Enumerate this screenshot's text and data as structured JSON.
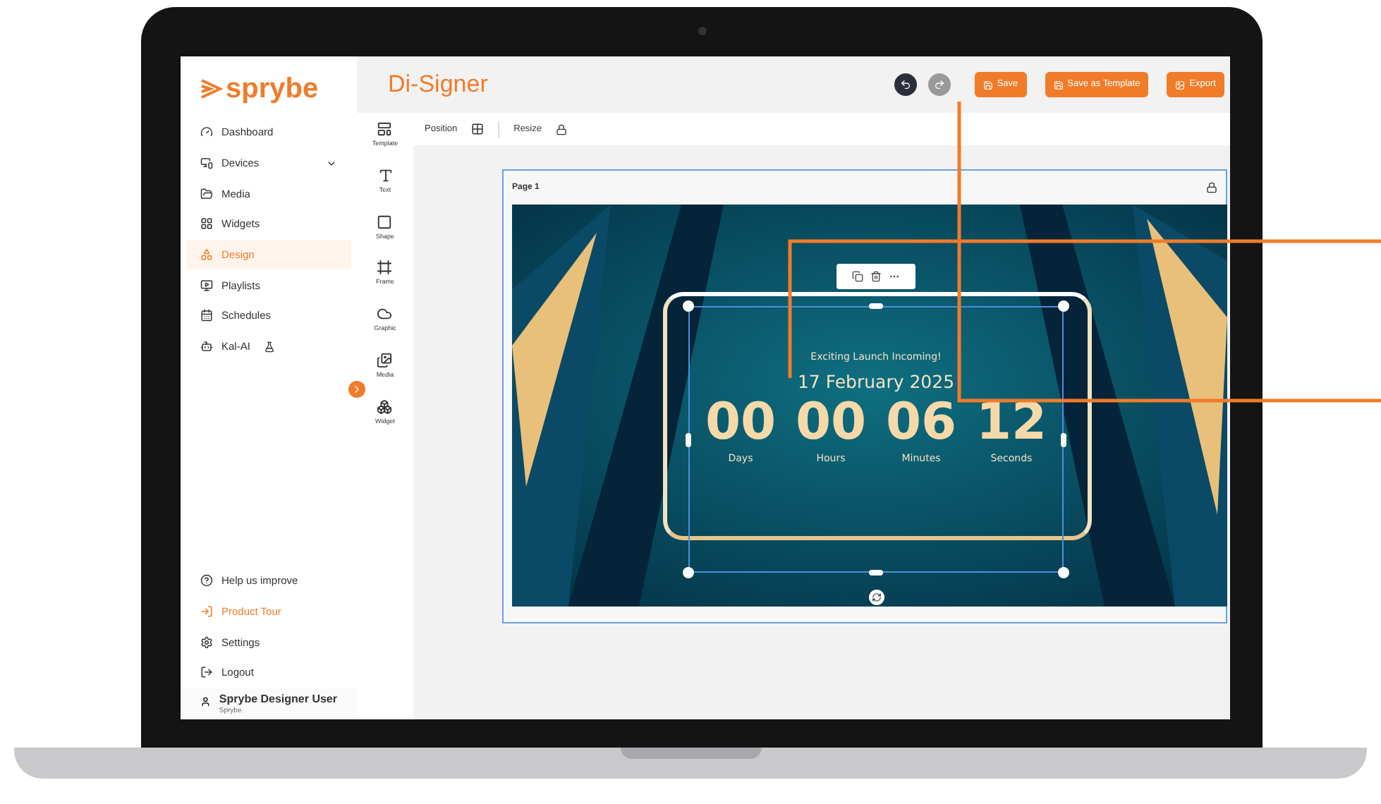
{
  "sidebar": {
    "logo": "sprybe",
    "items": [
      {
        "label": "Dashboard",
        "selected": false
      },
      {
        "label": "Devices",
        "selected": false,
        "expandable": true
      },
      {
        "label": "Media",
        "selected": false
      },
      {
        "label": "Widgets",
        "selected": false
      },
      {
        "label": "Design",
        "selected": true
      },
      {
        "label": "Playlists",
        "selected": false
      },
      {
        "label": "Schedules",
        "selected": false
      },
      {
        "label": "Kal-AI",
        "selected": false,
        "beta": true
      }
    ],
    "bottom_items": [
      {
        "label": "Help us improve",
        "accent": false
      },
      {
        "label": "Product Tour",
        "accent": true
      },
      {
        "label": "Settings",
        "accent": false
      },
      {
        "label": "Logout",
        "accent": false
      }
    ],
    "user": {
      "name": "Sprybe Designer User",
      "org": "Sprybe"
    }
  },
  "header": {
    "title": "Di-Signer",
    "undo_enabled": true,
    "redo_enabled": false,
    "buttons": [
      {
        "label": "Save"
      },
      {
        "label": "Save as Template"
      },
      {
        "label": "Export"
      }
    ]
  },
  "tools": [
    {
      "label": "Template"
    },
    {
      "label": "Text"
    },
    {
      "label": "Shape"
    },
    {
      "label": "Frame"
    },
    {
      "label": "Graphic"
    },
    {
      "label": "Media"
    },
    {
      "label": "Widget"
    }
  ],
  "toolbar": {
    "position": "Position",
    "resize": "Resize"
  },
  "page": {
    "label": "Page 1",
    "countdown": {
      "heading": "Exciting Launch Incoming!",
      "date": "17 February 2025",
      "units": [
        {
          "value": "00",
          "label": "Days"
        },
        {
          "value": "00",
          "label": "Hours"
        },
        {
          "value": "06",
          "label": "Minutes"
        },
        {
          "value": "12",
          "label": "Seconds"
        }
      ]
    }
  }
}
